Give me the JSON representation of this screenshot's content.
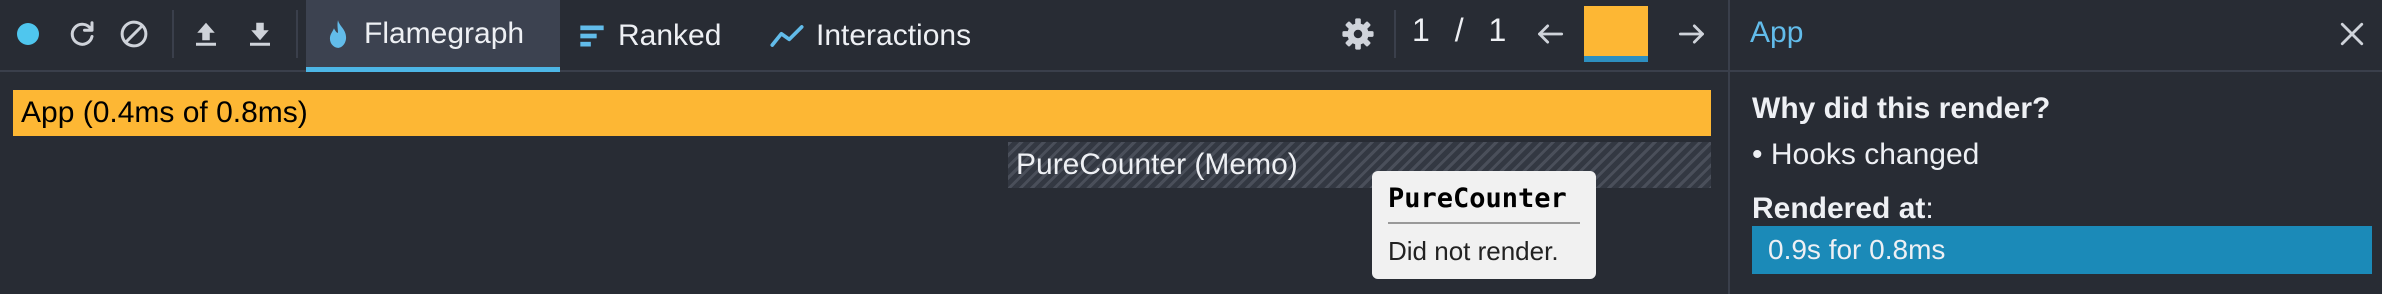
{
  "toolbar": {
    "icons": [
      "record-dot-icon",
      "reload-icon",
      "clear-icon",
      "upload-icon",
      "download-icon"
    ],
    "tabs": [
      {
        "label": "Flamegraph",
        "icon": "flame-icon",
        "active": true
      },
      {
        "label": "Ranked",
        "icon": "ranked-bars-icon",
        "active": false
      },
      {
        "label": "Interactions",
        "icon": "interactions-line-icon",
        "active": false
      }
    ],
    "settings_icon": "gear-icon",
    "pager": {
      "current": "1",
      "separator": "/",
      "total": "1"
    },
    "prev_icon": "arrow-left-icon",
    "next_icon": "arrow-right-icon",
    "commit_selected_color": "#fdb734"
  },
  "flamegraph": {
    "nodes": [
      {
        "label": "App (0.4ms of 0.8ms)",
        "color": "#fdb734"
      },
      {
        "label": "PureCounter (Memo)",
        "color": "hatched-gray"
      }
    ],
    "tooltip": {
      "title": "PureCounter",
      "body": "Did not render."
    }
  },
  "sidebar": {
    "title": "App",
    "close_icon": "close-icon",
    "why_heading": "Why did this render?",
    "reasons": [
      "• Hooks changed"
    ],
    "rendered_heading": "Rendered at",
    "rendered_colon": ":",
    "commits": [
      "0.9s for 0.8ms"
    ]
  },
  "colors": {
    "background": "#282c34",
    "accent": "#4db6e6",
    "bar": "#fdb734",
    "selected_row": "#1b8ab8"
  }
}
